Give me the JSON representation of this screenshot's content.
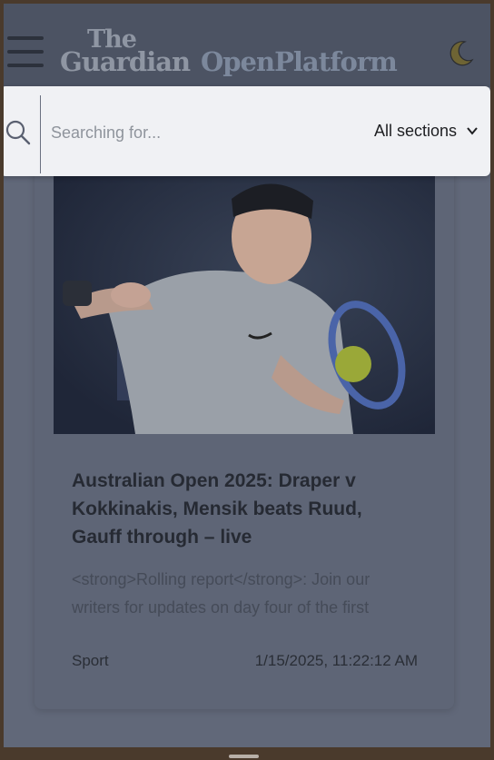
{
  "header": {
    "menu_icon": "hamburger-menu-icon",
    "logo": {
      "the": "The",
      "guardian": "Guardian",
      "open_platform": "OpenPlatform"
    },
    "theme_icon": "moon-icon"
  },
  "search": {
    "icon": "search-icon",
    "placeholder": "Searching for...",
    "value": "",
    "section_selected": "All sections"
  },
  "article": {
    "image_alt": "tennis player reaching for a ball",
    "title": "Australian Open 2025: Draper v Kokkinakis, Mensik beats Ruud, Gauff through – live",
    "summary": "<strong>Rolling report</strong>: Join our writers for updates on day four of the first",
    "section": "Sport",
    "date": "1/15/2025, 11:22:12 AM"
  },
  "colors": {
    "header_bg": "#4c5363",
    "overlay_bg": "#616879",
    "search_bg": "#f0f1f4",
    "card_bg": "#5e6576"
  }
}
